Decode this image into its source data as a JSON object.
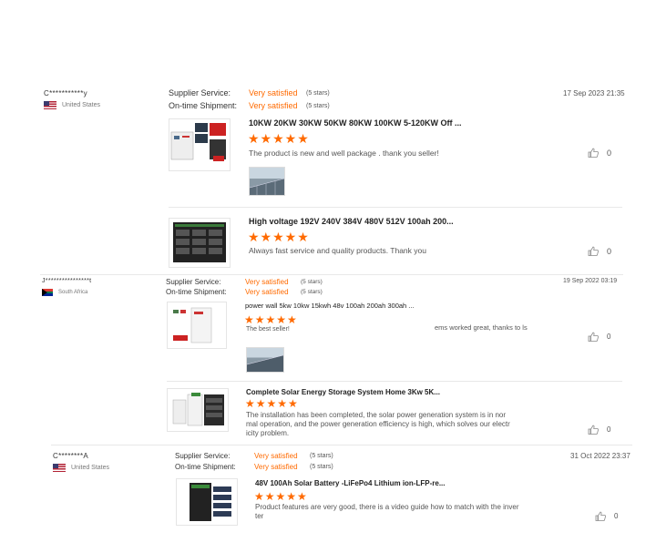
{
  "reviews": [
    {
      "reviewer": "C***********y",
      "country": "United States",
      "supplier_label": "Supplier Service:",
      "supplier_value": "Very satisfied",
      "supplier_stars": "(5 stars)",
      "shipment_label": "On-time Shipment:",
      "shipment_value": "Very satisfied",
      "shipment_stars": "(5 stars)",
      "date": "17 Sep 2023 21:35",
      "products": [
        {
          "title": "10KW 20KW 30KW 50KW 80KW 100KW 5-120KW Off ...",
          "stars": "★★★★★",
          "comment": "The product is new and well package . thank you seller!",
          "likes": "0"
        },
        {
          "title": "High voltage 192V 240V 384V 480V 512V 100ah 200...",
          "stars": "★★★★★",
          "comment": "Always fast service and quality products. Thank you",
          "likes": "0"
        }
      ]
    },
    {
      "reviewer": "J****************t",
      "country": "South Africa",
      "supplier_label": "Supplier Service:",
      "supplier_value": "Very satisfied",
      "supplier_stars": "(5 stars)",
      "shipment_label": "On-time Shipment:",
      "shipment_value": "Very satisfied",
      "shipment_stars": "(5 stars)",
      "date": "19 Sep 2022 03:19",
      "products": [
        {
          "title": "power wall 5kw 10kw 15kwh 48v 100ah 200ah 300ah ...",
          "stars": "★★★★★",
          "comment": "The best seller!",
          "comment_extra": "ems worked great, thanks to ls",
          "likes": "0"
        },
        {
          "title": "Complete Solar Energy Storage System Home 3Kw 5K...",
          "stars": "★★★★★",
          "comment_line1": "The installation has been completed, the solar power generation system is in nor",
          "comment_line2": "mal operation, and the power generation efficiency is high, which solves our electr",
          "comment_line3": "icity problem.",
          "likes": "0"
        }
      ]
    },
    {
      "reviewer": "C********A",
      "country": "United States",
      "supplier_label": "Supplier Service:",
      "supplier_value": "Very satisfied",
      "supplier_stars": "(5 stars)",
      "shipment_label": "On-time Shipment:",
      "shipment_value": "Very satisfied",
      "shipment_stars": "(5 stars)",
      "date": "31 Oct 2022 23:37",
      "products": [
        {
          "title": "48V 100Ah Solar Battery -LiFePo4 Lithium ion-LFP-re...",
          "stars": "★★★★★",
          "comment_line1": "Product features are very good, there is a video guide how to match with the inver",
          "comment_line2": "ter",
          "likes": "0"
        }
      ]
    }
  ],
  "colors": {
    "accent": "#ff6a00",
    "text": "#333333",
    "muted": "#777777"
  },
  "icons": {
    "like": "thumbs-up-icon",
    "flag_us": "us-flag-icon",
    "flag_za": "za-flag-icon"
  }
}
